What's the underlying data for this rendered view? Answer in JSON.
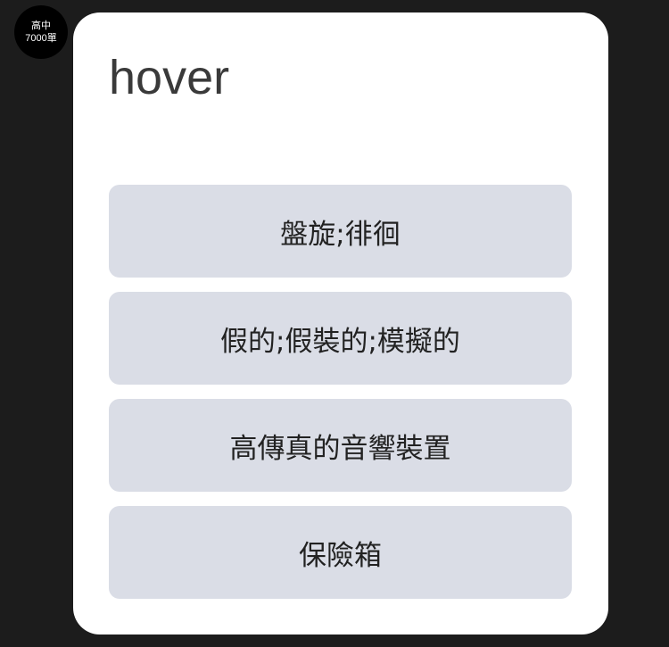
{
  "badge": {
    "line1": "高中",
    "line2": "7000單"
  },
  "word": "hover",
  "options": [
    {
      "label": "盤旋;徘徊"
    },
    {
      "label": "假的;假裝的;模擬的"
    },
    {
      "label": "高傳真的音響裝置"
    },
    {
      "label": "保險箱"
    }
  ]
}
